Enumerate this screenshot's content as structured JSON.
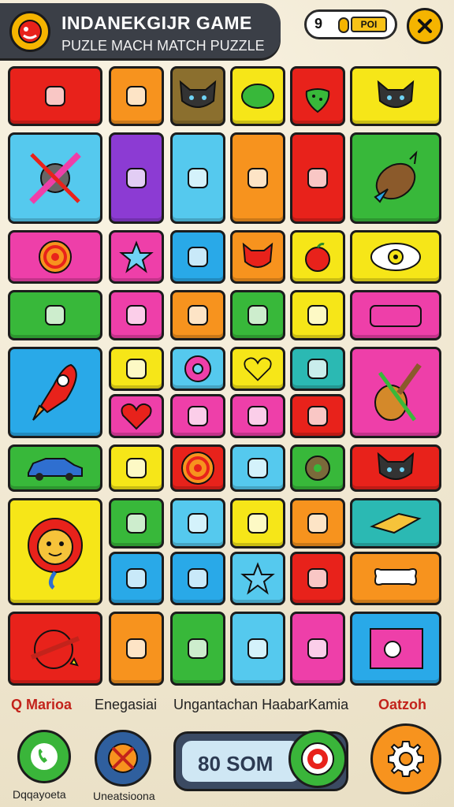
{
  "header": {
    "title": "INDANEKGIJR GAME",
    "subtitle": "PUZLE MACH MATCH PUZZLE",
    "status_left": "9",
    "status_gold_label": "POI"
  },
  "labels": {
    "left": "Q Marioa",
    "center_left": "Enegasiai",
    "center": "Ungantachan HaabarKamia",
    "right": "Oatzoh"
  },
  "score": {
    "text": "80 SOM"
  },
  "captions": {
    "left": "Dqqayoeta",
    "second": "Uneatsioona"
  },
  "colors": {
    "red": "#e8221b",
    "orange": "#f7931e",
    "yellow": "#f6e618",
    "green": "#38b83a",
    "blue": "#29a9e8",
    "sky": "#55c9ee",
    "pink": "#ee3fa9",
    "purple": "#8c3bd3",
    "brown": "#8b6f2e",
    "teal": "#2bb9b3"
  },
  "tiles": [
    {
      "icon": "dropper-icon",
      "color": "red"
    },
    {
      "icon": "backpack-icon",
      "color": "orange"
    },
    {
      "icon": "cat-face-icon",
      "color": "brown"
    },
    {
      "icon": "lime-icon",
      "color": "yellow"
    },
    {
      "icon": "strawberry-icon",
      "color": "red"
    },
    {
      "icon": "cat-face-icon",
      "color": "yellow"
    },
    {
      "icon": "crossed-tools-icon",
      "color": "sky"
    },
    {
      "icon": "bottle-icon",
      "color": "purple"
    },
    {
      "icon": "swirl-leaf-icon",
      "color": "sky"
    },
    {
      "icon": "arrow-up-icon",
      "color": "orange"
    },
    {
      "icon": "jellyfish-icon",
      "color": "red"
    },
    {
      "icon": "carrot-icon",
      "color": "green"
    },
    {
      "icon": "spiral-icon",
      "color": "pink"
    },
    {
      "icon": "star-icon",
      "color": "pink"
    },
    {
      "icon": "hammer-icon",
      "color": "blue"
    },
    {
      "icon": "fox-face-icon",
      "color": "orange"
    },
    {
      "icon": "apple-icon",
      "color": "yellow"
    },
    {
      "icon": "eye-icon",
      "color": "yellow"
    },
    {
      "icon": "bell-icon",
      "color": "green"
    },
    {
      "icon": "palm-tree-icon",
      "color": "pink"
    },
    {
      "icon": "knife-leaf-icon",
      "color": "orange"
    },
    {
      "icon": "table-icon",
      "color": "green"
    },
    {
      "icon": "box-icon",
      "color": "yellow"
    },
    {
      "icon": "gamepad-icon",
      "color": "pink"
    },
    {
      "icon": "rocket-icon",
      "color": "blue"
    },
    {
      "icon": "speech-bubble-icon",
      "color": "yellow"
    },
    {
      "icon": "donut-icon",
      "color": "sky"
    },
    {
      "icon": "heart-outline-icon",
      "color": "yellow"
    },
    {
      "icon": "pencil-icon",
      "color": "teal"
    },
    {
      "icon": "guitar-icon",
      "color": "pink"
    },
    {
      "icon": "heart-icon",
      "color": "pink"
    },
    {
      "icon": "face-icon",
      "color": "pink"
    },
    {
      "icon": "drop-icon",
      "color": "pink"
    },
    {
      "icon": "scroll-icon",
      "color": "red"
    },
    {
      "icon": "car-icon",
      "color": "green"
    },
    {
      "icon": "bag-icon",
      "color": "yellow"
    },
    {
      "icon": "spiral-icon",
      "color": "red"
    },
    {
      "icon": "card-icon",
      "color": "sky"
    },
    {
      "icon": "ring-icon",
      "color": "green"
    },
    {
      "icon": "cat-face-icon",
      "color": "red"
    },
    {
      "icon": "lion-face-icon",
      "color": "yellow"
    },
    {
      "icon": "splash-icon",
      "color": "green"
    },
    {
      "icon": "jar-icon",
      "color": "sky"
    },
    {
      "icon": "c-letter-icon",
      "color": "yellow"
    },
    {
      "icon": "blob-icon",
      "color": "orange"
    },
    {
      "icon": "tape-icon",
      "color": "teal"
    },
    {
      "icon": "can-icon",
      "color": "blue"
    },
    {
      "icon": "cookie-icon",
      "color": "blue"
    },
    {
      "icon": "star-icon",
      "color": "sky"
    },
    {
      "icon": "hearts-icon",
      "color": "red"
    },
    {
      "icon": "bone-icon",
      "color": "orange"
    },
    {
      "icon": "planet-icon",
      "color": "red"
    },
    {
      "icon": "jam-jar-icon",
      "color": "orange"
    },
    {
      "icon": "basket-icon",
      "color": "green"
    },
    {
      "icon": "phone-icon",
      "color": "sky"
    },
    {
      "icon": "eraser-icon",
      "color": "pink"
    },
    {
      "icon": "photo-icon",
      "color": "blue"
    }
  ]
}
